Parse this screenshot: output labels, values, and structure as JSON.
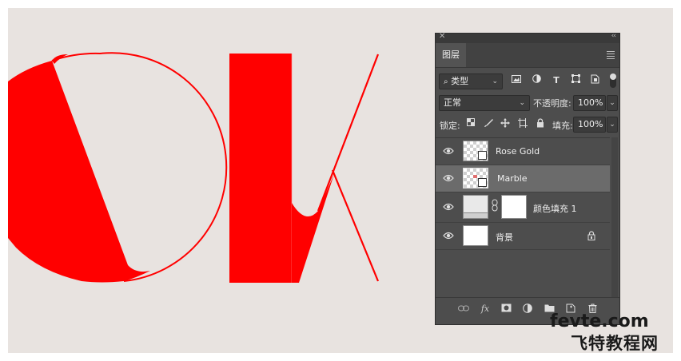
{
  "panel": {
    "tab_title": "图层",
    "close_glyph": "✕",
    "collapse_glyph": "‹‹",
    "filter_kind": "类型",
    "blend_mode": "正常",
    "opacity_label": "不透明度:",
    "opacity_value": "100%",
    "lock_label": "锁定:",
    "fill_label": "填充:",
    "fill_value": "100%",
    "layers": [
      {
        "name": "Rose Gold",
        "visible": true,
        "selected": false,
        "thumb": "smart-object"
      },
      {
        "name": "Marble",
        "visible": true,
        "selected": true,
        "thumb": "smart-object"
      },
      {
        "name": "颜色填充 1",
        "visible": true,
        "selected": false,
        "thumb": "fill-with-mask"
      },
      {
        "name": "背景",
        "visible": true,
        "selected": false,
        "thumb": "white",
        "locked": true
      }
    ],
    "bottom_icons": [
      "link-icon",
      "fx-icon",
      "mask-icon",
      "adjustment-icon",
      "folder-icon",
      "new-layer-icon",
      "trash-icon"
    ],
    "fx_label": "fx"
  },
  "artwork": {
    "letter_color": "#ff0000",
    "canvas_color": "#e8e3e0"
  },
  "watermark": {
    "line1": "fevte.com",
    "line2": "飞特教程网"
  }
}
